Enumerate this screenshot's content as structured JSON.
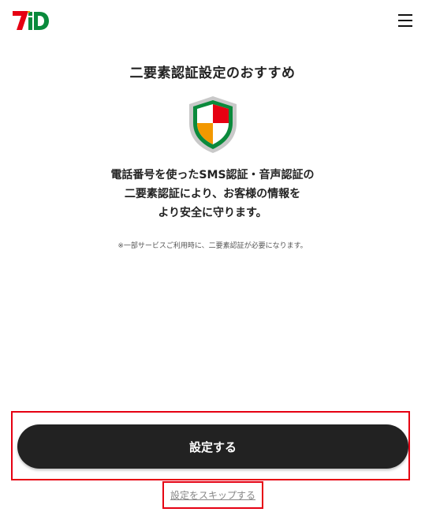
{
  "header": {
    "logo_icon": "7id-logo-icon",
    "menu_icon": "hamburger-menu-icon",
    "brand_colors": {
      "red": "#e60012",
      "green": "#0a8a3c",
      "orange": "#f39800"
    }
  },
  "main": {
    "title": "二要素認証設定のおすすめ",
    "shield_icon": "security-shield-icon",
    "description_lines": [
      "電話番号を使ったSMS認証・音声認証の",
      "二要素認証により、お客様の情報を",
      "より安全に守ります。"
    ],
    "note": "※一部サービスご利用時に、二要素認証が必要になります。"
  },
  "actions": {
    "primary_label": "設定する",
    "skip_label": "設定をスキップする",
    "highlight_color": "#e60012"
  }
}
